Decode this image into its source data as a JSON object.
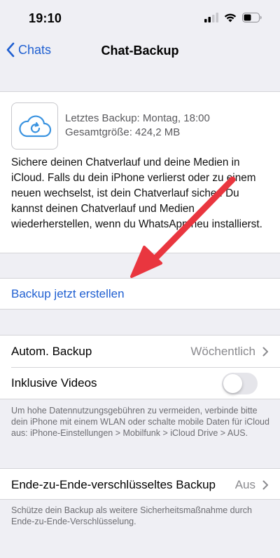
{
  "status_bar": {
    "time": "19:10"
  },
  "nav": {
    "back_label": "Chats",
    "title": "Chat-Backup"
  },
  "backup": {
    "last_backup": "Letztes Backup: Montag, 18:00",
    "total_size": "Gesamtgröße: 424,2 MB",
    "description": "Sichere deinen Chatverlauf und deine Medien in iCloud. Falls du dein iPhone verlierst oder zu einem neuen wechselst, ist dein Chatverlauf sicher. Du kannst deinen Chatverlauf und Medien wiederherstellen, wenn du WhatsApp neu installierst."
  },
  "actions": {
    "backup_now": "Backup jetzt erstellen"
  },
  "settings": {
    "auto_backup_label": "Autom. Backup",
    "auto_backup_value": "Wöchentlich",
    "include_videos_label": "Inklusive Videos",
    "include_videos_on": false,
    "note": "Um hohe Datennutzungsgebühren zu vermeiden, verbinde bitte dein iPhone mit einem WLAN oder schalte mobile Daten für iCloud aus: iPhone-Einstellungen > Mobilfunk > iCloud Drive > AUS."
  },
  "e2e": {
    "label": "Ende-zu-Ende-verschlüsseltes Backup",
    "value": "Aus",
    "note": "Schütze dein Backup als weitere Sicherheitsmaßnahme durch Ende-zu-Ende-Verschlüsselung."
  },
  "colors": {
    "accent": "#1f5fd1",
    "annotation_arrow": "#e9363f",
    "background": "#efeff4"
  },
  "icons": [
    "signal-icon",
    "wifi-icon",
    "battery-icon",
    "back-chevron-icon",
    "icloud-icon",
    "chevron-right-icon",
    "annotation-arrow"
  ]
}
